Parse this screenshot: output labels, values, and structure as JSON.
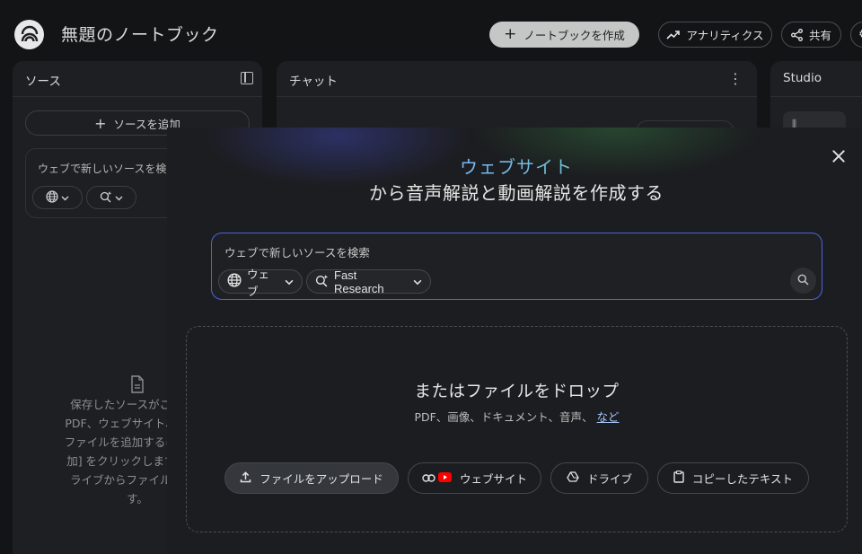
{
  "app": {
    "title": "無題のノートブック"
  },
  "header": {
    "create_label": "ノートブックを作成",
    "analytics_label": "アナリティクス",
    "share_label": "共有"
  },
  "sources": {
    "title": "ソース",
    "add_label": "ソースを追加",
    "search_placeholder": "ウェブで新しいソースを検",
    "empty_text": "保存したソースがここに表\nPDF、ウェブサイト、テキス\nファイルを追加するには、上\n加] をクリックします。また\nライブからファイルを直接\nす。"
  },
  "chat": {
    "title": "チャット"
  },
  "studio": {
    "title": "Studio"
  },
  "modal": {
    "heading_highlight": "ウェブサイト",
    "heading_rest": "から音声解説と動画解説を作成する",
    "search": {
      "placeholder": "ウェブで新しいソースを検索",
      "source_chip": "ウェブ",
      "mode_chip": "Fast Research"
    },
    "drop": {
      "title": "またはファイルをドロップ",
      "subtitle": "PDF、画像、ドキュメント、音声、",
      "more_link": "など"
    },
    "buttons": {
      "upload": "ファイルをアップロード",
      "website": "ウェブサイト",
      "drive": "ドライブ",
      "paste": "コピーしたテキスト"
    }
  },
  "colors": {
    "accent_border": "#5062e0",
    "gradient_blue": "#6f8cff",
    "gradient_green": "#58d27a",
    "youtube_red": "#ff0000",
    "link": "#a8c7fa"
  }
}
